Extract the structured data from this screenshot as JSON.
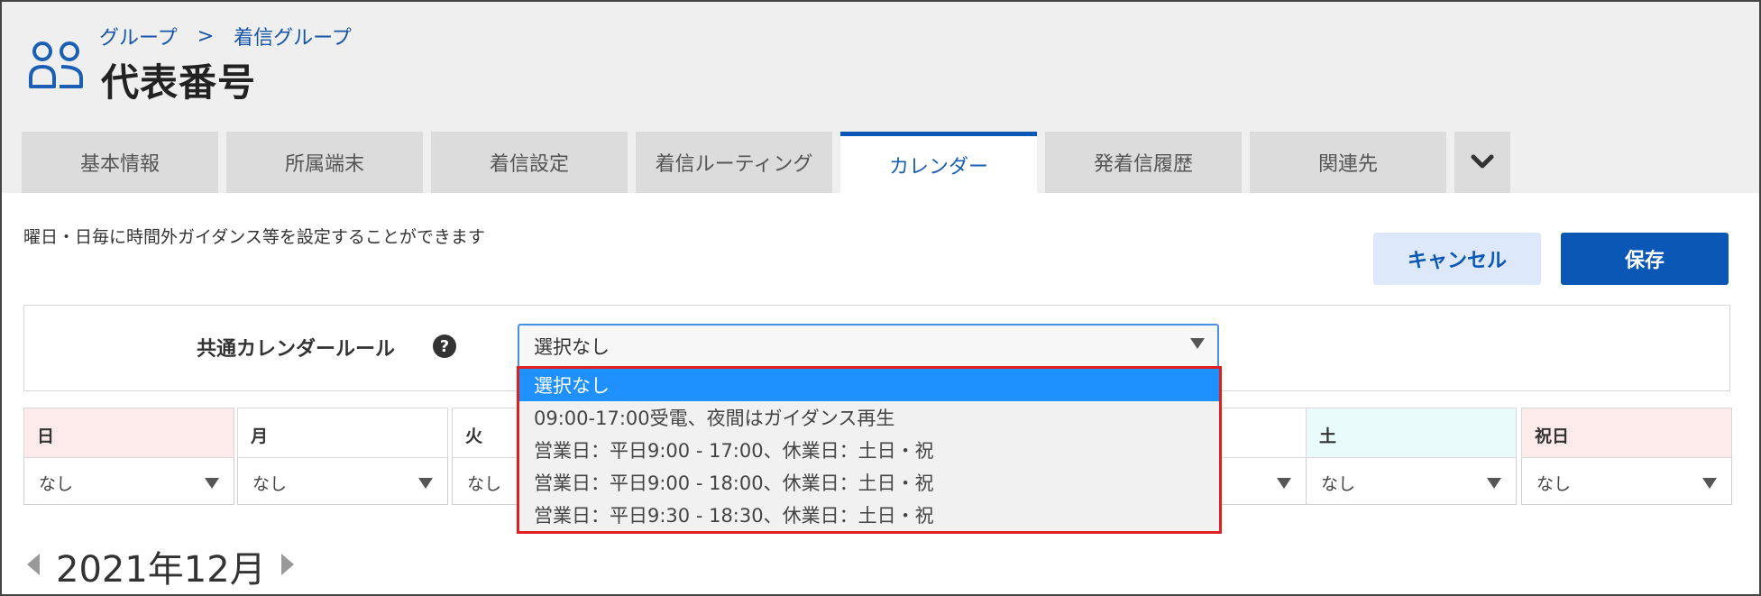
{
  "breadcrumb": {
    "items": [
      "グループ",
      "着信グループ"
    ],
    "separator": ">"
  },
  "page": {
    "title": "代表番号",
    "icon": "group-icon"
  },
  "tabs": [
    {
      "label": "基本情報"
    },
    {
      "label": "所属端末"
    },
    {
      "label": "着信設定"
    },
    {
      "label": "着信ルーティング"
    },
    {
      "label": "カレンダー",
      "active": true
    },
    {
      "label": "発着信履歴"
    },
    {
      "label": "関連先"
    }
  ],
  "tab_more_icon": "chevron-down-icon",
  "main": {
    "description": "曜日・日毎に時間外ガイダンス等を設定することができます",
    "cancel_label": "キャンセル",
    "save_label": "保存"
  },
  "common_rule": {
    "label": "共通カレンダールール",
    "help_icon": "question-circle-icon",
    "help_glyph": "?",
    "selected": "選択なし",
    "options": [
      "選択なし",
      "09:00-17:00受電、夜間はガイダンス再生",
      "営業日：平日9:00 - 17:00、休業日：土日・祝",
      "営業日：平日9:00 - 18:00、休業日：土日・祝",
      "営業日：平日9:30 - 18:30、休業日：土日・祝"
    ]
  },
  "days": [
    {
      "label": "日",
      "value": "なし",
      "color": "#fdeaea"
    },
    {
      "label": "月",
      "value": "なし",
      "color": "#ffffff"
    },
    {
      "label": "火",
      "value": "なし",
      "color": "#ffffff"
    },
    {
      "label": "",
      "value": "",
      "color": "#ffffff"
    },
    {
      "label": "",
      "value": "",
      "color": "#ffffff"
    },
    {
      "label": "",
      "value": "",
      "color": "#ffffff"
    },
    {
      "label": "土",
      "value": "なし",
      "color": "#e9fbfb"
    },
    {
      "label": "祝日",
      "value": "なし",
      "color": "#fdeaea"
    }
  ],
  "calendar": {
    "month_label": "2021年12月"
  },
  "colors": {
    "accent": "#0b57b5",
    "highlight": "#1e90ff",
    "dropdown_border": "#e02020"
  }
}
